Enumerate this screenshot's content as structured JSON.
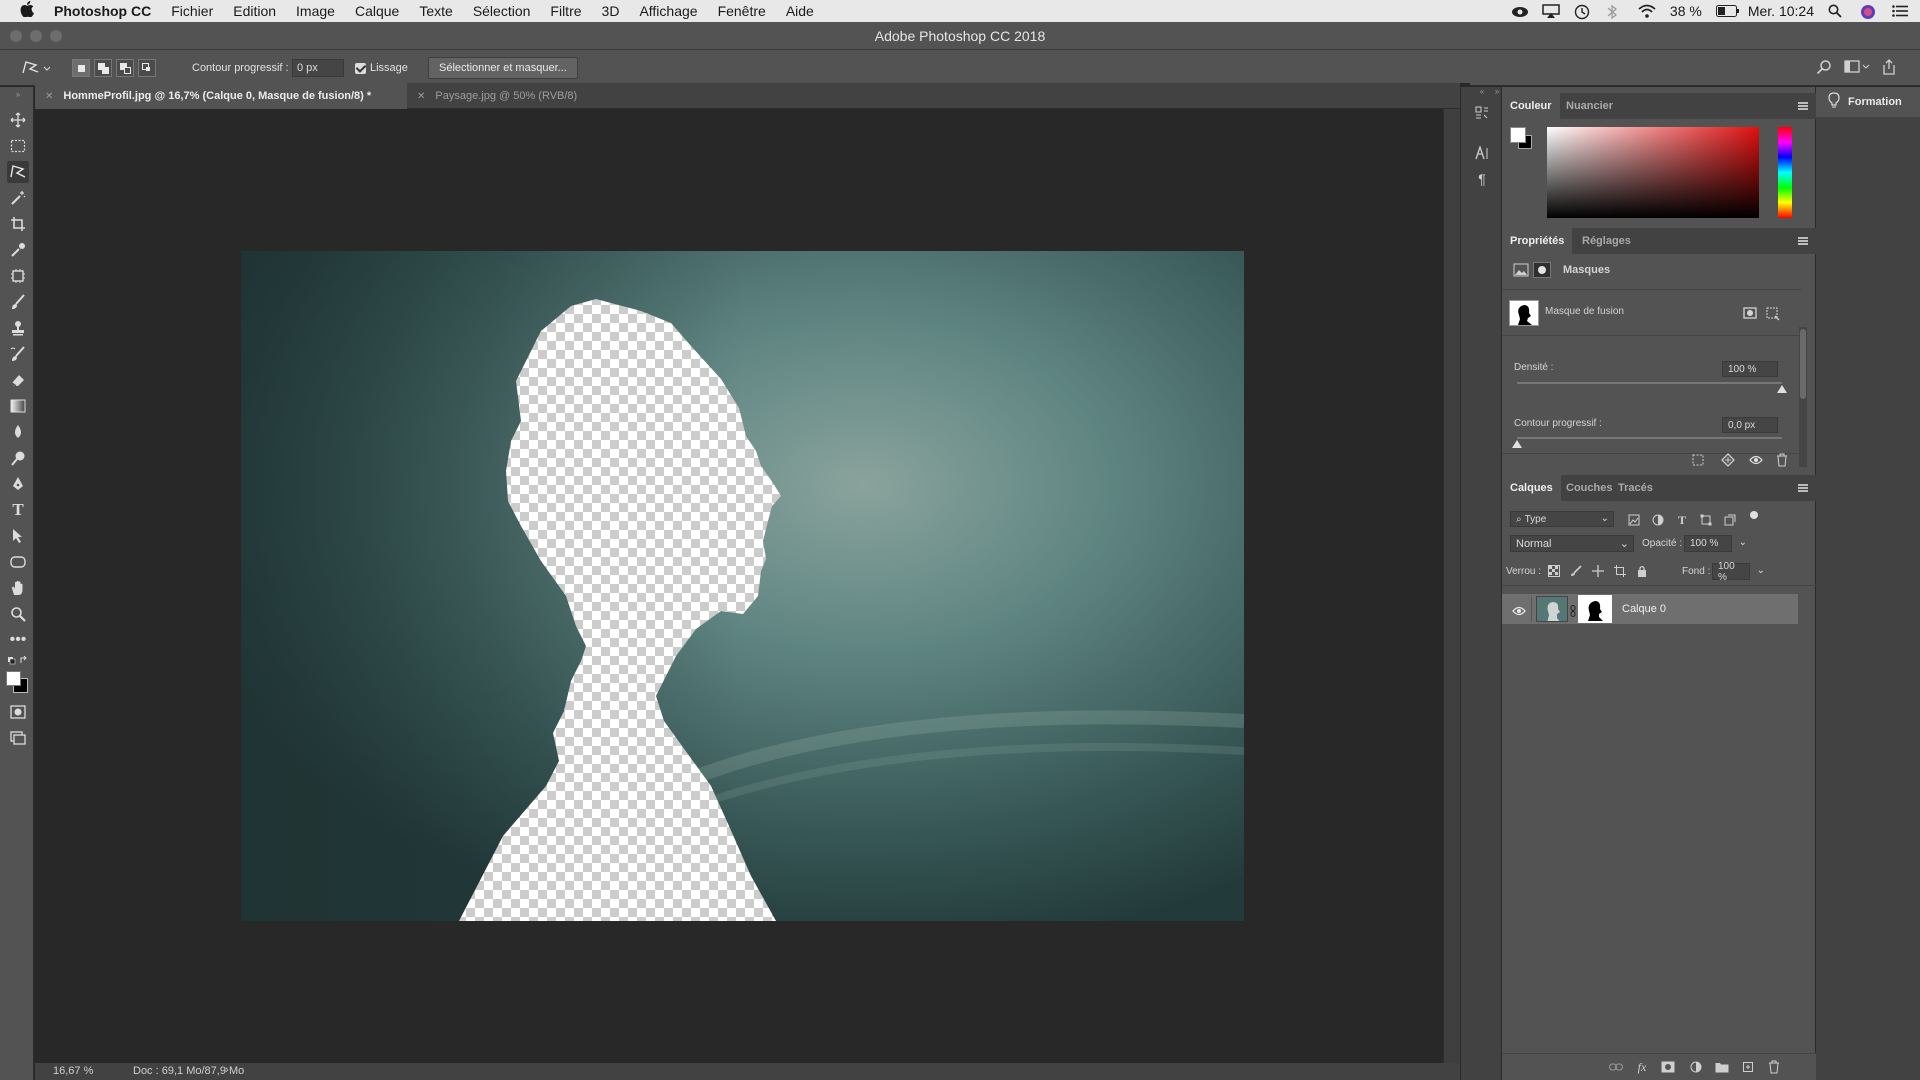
{
  "menubar": {
    "apple": "",
    "items": [
      "Photoshop CC",
      "Fichier",
      "Edition",
      "Image",
      "Calque",
      "Texte",
      "Sélection",
      "Filtre",
      "3D",
      "Affichage",
      "Fenêtre",
      "Aide"
    ],
    "battery": "38 %",
    "clock": "Mer. 10:24"
  },
  "window": {
    "title": "Adobe Photoshop CC 2018"
  },
  "options": {
    "feather_label": "Contour progressif :",
    "feather_value": "0 px",
    "smoothing_label": "Lissage",
    "select_mask_button": "Sélectionner et masquer..."
  },
  "tabs": [
    {
      "label": "HommeProfil.jpg @ 16,7% (Calque 0, Masque de fusion/8) *",
      "active": true
    },
    {
      "label": "Paysage.jpg @ 50% (RVB/8)",
      "active": false
    }
  ],
  "status": {
    "zoom": "16,67 %",
    "doc": "Doc : 69,1 Mo/87,9 Mo",
    "arrow": "›"
  },
  "color_panel": {
    "tabs": [
      "Couleur",
      "Nuancier"
    ],
    "foreground": "#ffffff",
    "background": "#000000",
    "hue_color": "#e01010"
  },
  "properties_panel": {
    "tabs": [
      "Propriétés",
      "Réglages"
    ],
    "section": "Masques",
    "mask_label": "Masque de fusion",
    "density_label": "Densité :",
    "density_value": "100 %",
    "density_level": 1.0,
    "feather_label": "Contour progressif :",
    "feather_value": "0,0 px",
    "feather_level": 0.0
  },
  "layers_panel": {
    "tabs": [
      "Calques",
      "Couches",
      "Tracés"
    ],
    "filter_label": "Type",
    "blend_mode": "Normal",
    "opacity_label": "Opacité :",
    "opacity_value": "100 %",
    "lock_label": "Verrou :",
    "fill_label": "Fond :",
    "fill_value": "100 %",
    "layers": [
      {
        "name": "Calque 0",
        "visible": true,
        "selected": true
      }
    ]
  },
  "learn_panel": {
    "label": "Formation"
  }
}
